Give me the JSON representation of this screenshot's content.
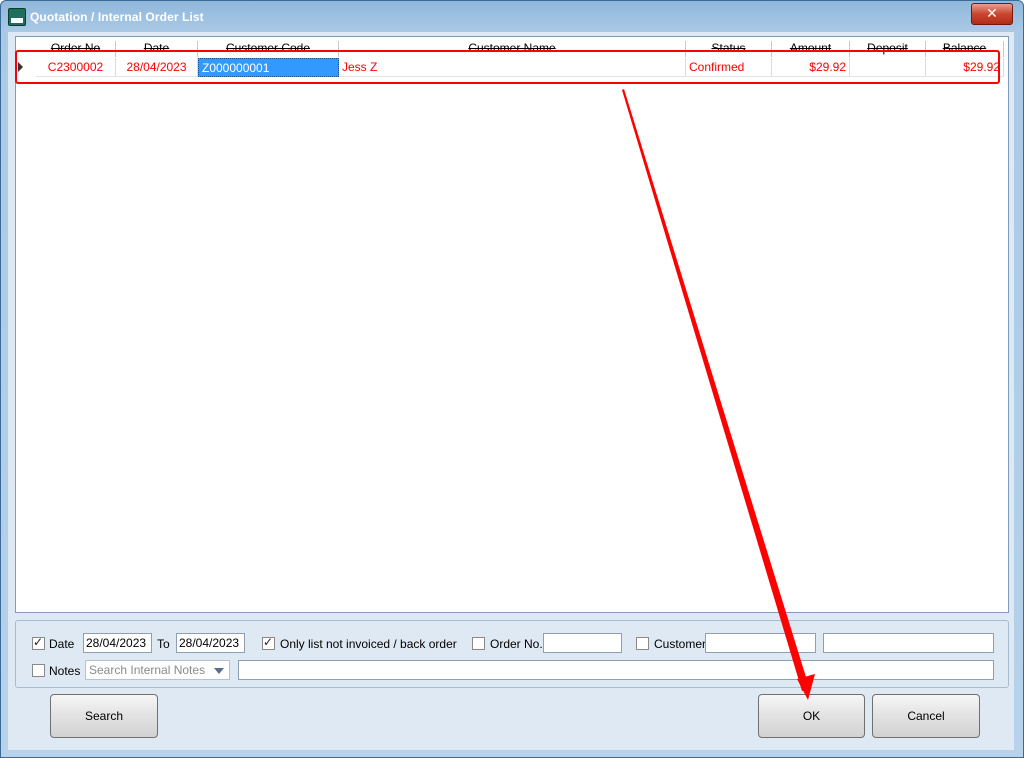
{
  "window": {
    "title": "Quotation / Internal Order List",
    "close_glyph": "✕"
  },
  "grid": {
    "columns": [
      "Order No",
      "Date",
      "Customer Code",
      "Customer Name",
      "Status",
      "Amount",
      "Deposit",
      "Balance"
    ],
    "rows": [
      {
        "order_no": "C2300002",
        "date": "28/04/2023",
        "customer_code": "Z000000001",
        "customer_name": "Jess Z",
        "status": "Confirmed",
        "amount": "$29.92",
        "deposit": "",
        "balance": "$29.92"
      }
    ]
  },
  "filters": {
    "date_label": "Date",
    "date_from": "28/04/2023",
    "to_label": "To",
    "date_to": "28/04/2023",
    "only_list_label": "Only list not invoiced / back order",
    "order_no_label": "Order No.",
    "order_no_value": "",
    "customer_label": "Customer",
    "customer_value": "",
    "customer_value2": "",
    "notes_label": "Notes",
    "notes_combo_placeholder": "Search Internal Notes",
    "notes_value": "",
    "date_checked": true,
    "only_list_checked": true,
    "order_no_checked": false,
    "customer_checked": false,
    "notes_checked": false
  },
  "buttons": {
    "search": "Search",
    "ok": "OK",
    "cancel": "Cancel"
  },
  "colors": {
    "row_text": "#ff0000",
    "selection": "#3399ff",
    "annotation": "#ff0000"
  }
}
